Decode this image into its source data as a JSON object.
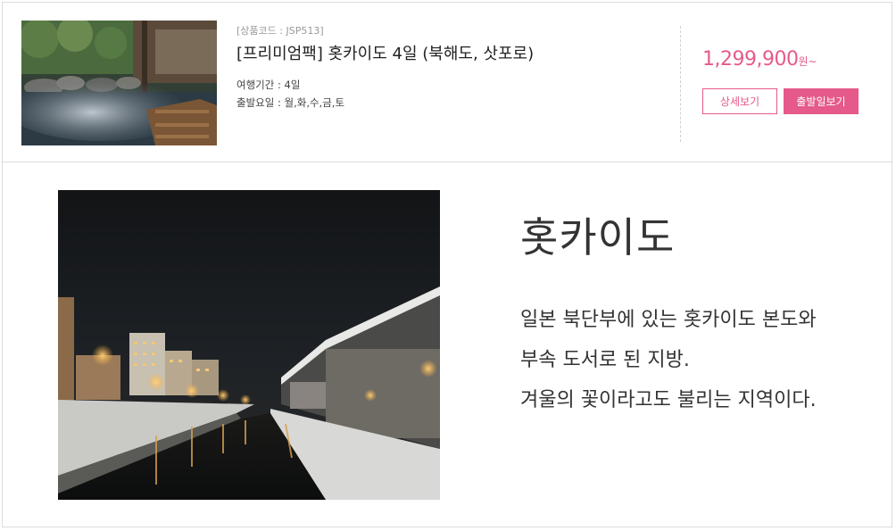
{
  "product": {
    "code": "[상품코드 : JSP513]",
    "title": "[프리미엄팩] 홋카이도 4일 (북해도, 삿포로)",
    "duration": "여행기간 : 4일",
    "departure_days": "출발요일 : 월,화,수,금,토",
    "price": "1,299,900",
    "price_unit": "원~",
    "detail_button": "상세보기",
    "departure_button": "출발일보기",
    "thumbnail": "onsen-hot-spring-photo"
  },
  "feature": {
    "region": "홋카이도",
    "description_lines": [
      "일본 북단부에 있는 홋카이도 본도와",
      "부속 도서로 된 지방.",
      "겨울의 꽃이라고도 불리는 지역이다."
    ],
    "photo": "otaru-canal-night-photo"
  },
  "colors": {
    "accent": "#e55a8a",
    "border": "#dcdcdc",
    "text": "#333333",
    "muted": "#999999"
  }
}
